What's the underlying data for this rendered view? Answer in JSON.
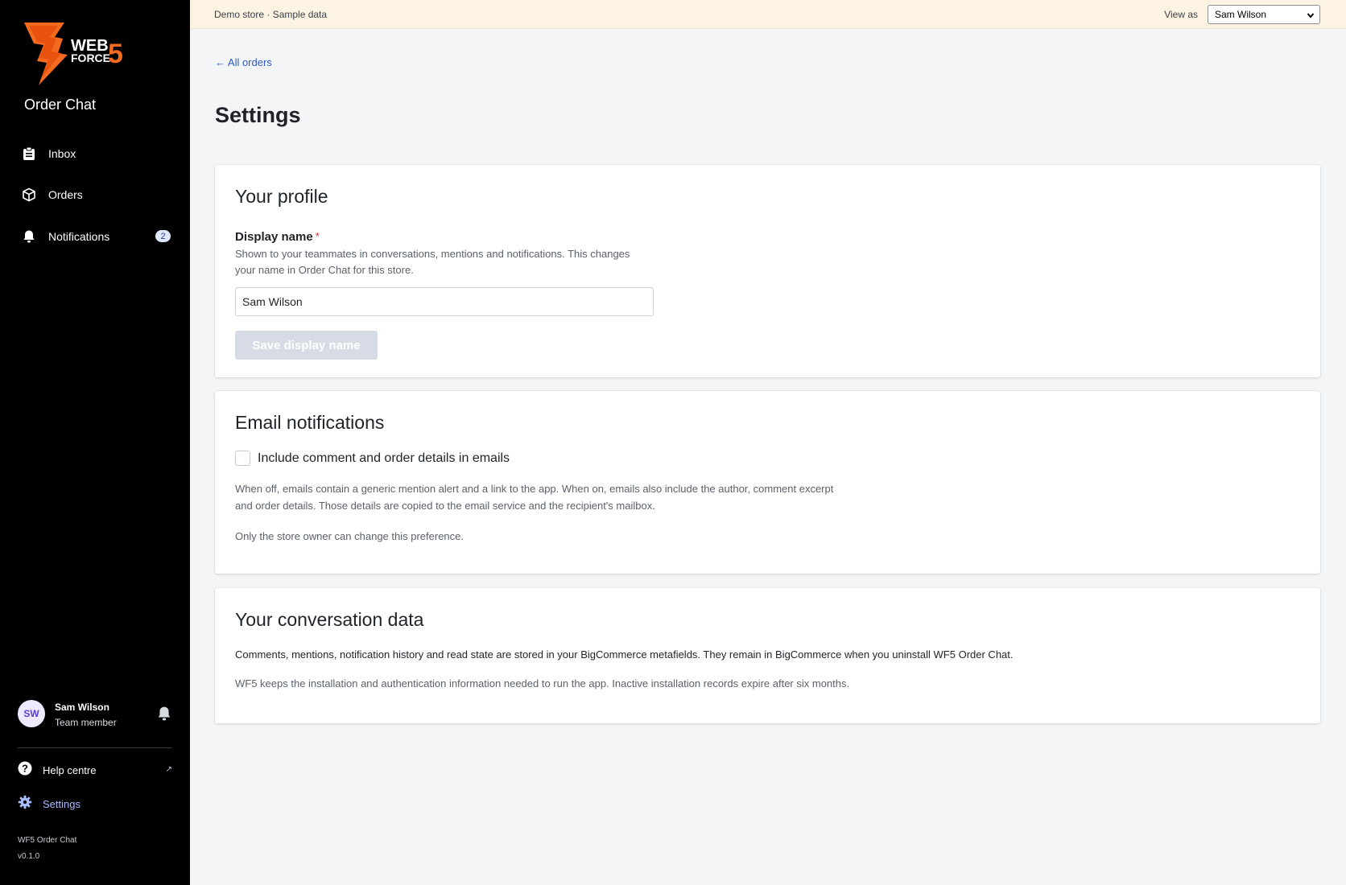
{
  "sidebar": {
    "logo_top": "WEB",
    "logo_bottom": "FORCE",
    "logo_number": "5",
    "app_name": "Order Chat",
    "nav": [
      {
        "label": "Inbox",
        "icon": "clipboard-icon"
      },
      {
        "label": "Orders",
        "icon": "box-icon"
      },
      {
        "label": "Notifications",
        "icon": "bell-icon",
        "badge": "2"
      }
    ],
    "user": {
      "initials": "SW",
      "name": "Sam Wilson",
      "role": "Team member"
    },
    "footer_links": [
      {
        "label": "Help centre",
        "icon": "help-icon",
        "external": true
      },
      {
        "label": "Settings",
        "icon": "gear-icon",
        "active": true
      }
    ],
    "app_meta": {
      "name": "WF5 Order Chat",
      "version": "v0.1.0"
    }
  },
  "topbar": {
    "store_text": "Demo store · Sample data",
    "view_as_label": "View as",
    "view_as_value": "Sam Wilson"
  },
  "main": {
    "back_link": "← All orders",
    "title": "Settings",
    "profile": {
      "title": "Your profile",
      "field_label": "Display name",
      "required_mark": "*",
      "help": "Shown to your teammates in conversations, mentions and notifications. This changes your name in Order Chat for this store.",
      "input_value": "Sam Wilson",
      "save_label": "Save display name"
    },
    "email": {
      "title": "Email notifications",
      "checkbox_label": "Include comment and order details in emails",
      "checked": false,
      "para1": "When off, emails contain a generic mention alert and a link to the app. When on, emails also include the author, comment excerpt and order details. Those details are copied to the email service and the recipient's mailbox.",
      "para2": "Only the store owner can change this preference."
    },
    "data": {
      "title": "Your conversation data",
      "para1": "Comments, mentions, notification history and read state are stored in your BigCommerce metafields. They remain in BigCommerce when you uninstall WF5 Order Chat.",
      "para2": "WF5 keeps the installation and authentication information needed to run the app. Inactive installation records expire after six months."
    }
  },
  "colors": {
    "brand_orange": "#f46a1e",
    "link_blue": "#2f57c7",
    "active_nav": "#a9bcff",
    "banner": "#fdf3e3"
  }
}
